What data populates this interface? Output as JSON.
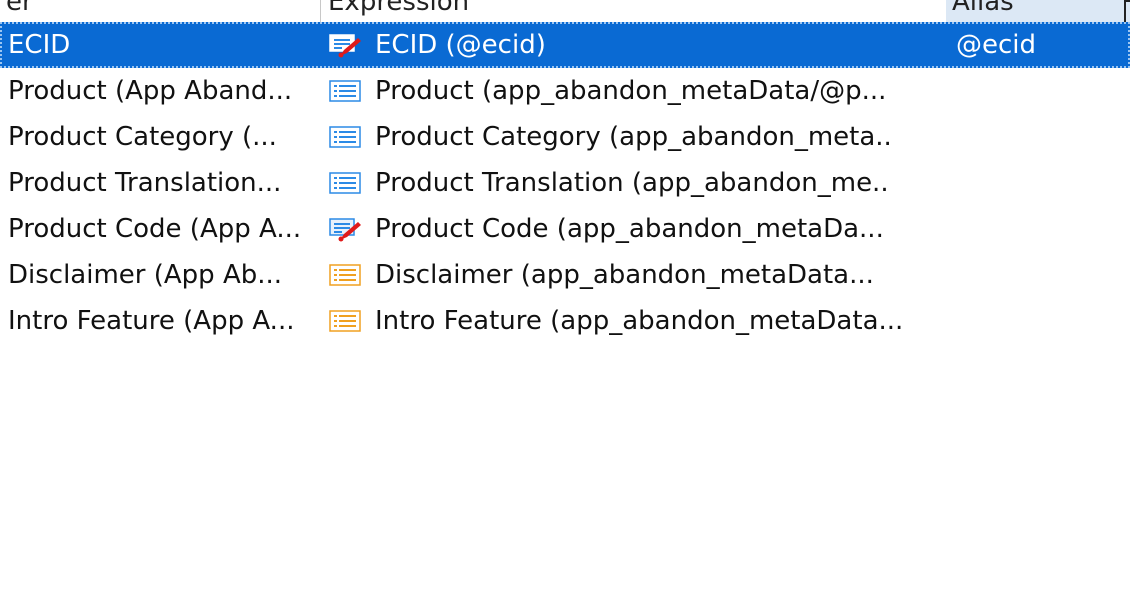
{
  "columns": {
    "name": "er",
    "expression": "Expression",
    "alias": "Alias"
  },
  "colors": {
    "selected": "#0a6ad3",
    "list_icon_blue": "#2b8ae6",
    "list_icon_orange": "#f0a020",
    "edit_mark_red": "#e01a1a"
  },
  "rows": [
    {
      "name": "ECID",
      "expression": "ECID (@ecid)",
      "alias": "@ecid",
      "icon": "list-edit-icon",
      "selected": true
    },
    {
      "name": "Product (App Aband...",
      "expression": "Product (app_abandon_metaData/@p...",
      "alias": "",
      "icon": "list-icon-blue",
      "selected": false
    },
    {
      "name": "Product Category (...",
      "expression": "Product Category (app_abandon_meta..",
      "alias": "",
      "icon": "list-icon-blue",
      "selected": false
    },
    {
      "name": "Product Translation...",
      "expression": "Product Translation (app_abandon_me..",
      "alias": "",
      "icon": "list-icon-blue",
      "selected": false
    },
    {
      "name": "Product Code (App A...",
      "expression": "Product Code (app_abandon_metaDa...",
      "alias": "",
      "icon": "list-edit-icon",
      "selected": false
    },
    {
      "name": "Disclaimer (App Ab...",
      "expression": "Disclaimer (app_abandon_metaData...",
      "alias": "",
      "icon": "list-icon-orange",
      "selected": false
    },
    {
      "name": "Intro Feature (App A...",
      "expression": "Intro Feature (app_abandon_metaData...",
      "alias": "",
      "icon": "list-icon-orange",
      "selected": false
    }
  ]
}
